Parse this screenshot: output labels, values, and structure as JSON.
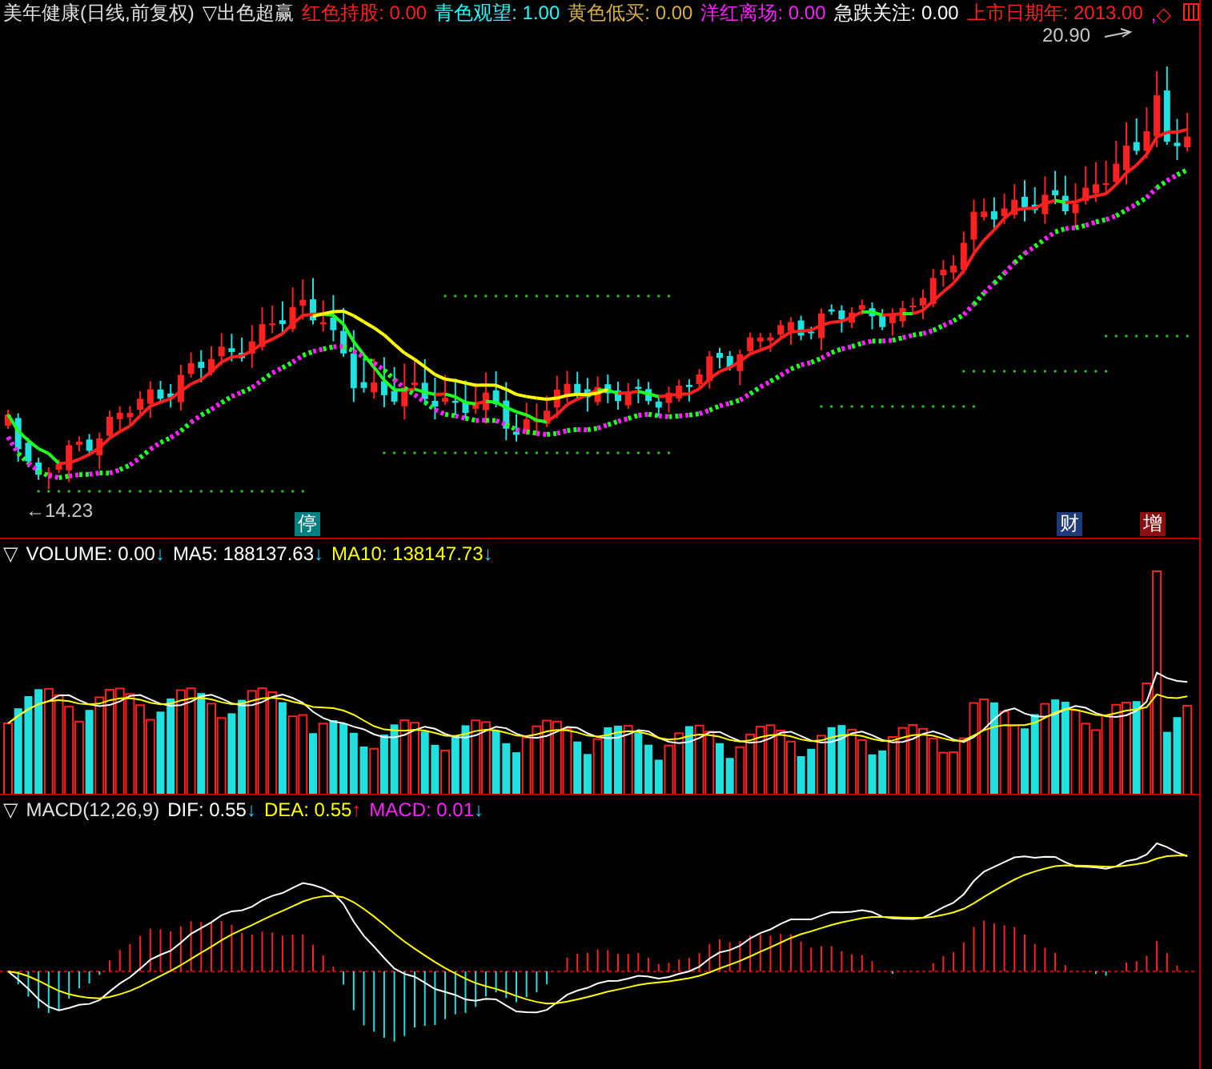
{
  "header": {
    "title": "美年健康(日线,前复权)",
    "indicator": "▽出色超赢",
    "readings": [
      {
        "label": "红色持股:",
        "value": "0.00",
        "color": "#ff2020"
      },
      {
        "label": "青色观望:",
        "value": "1.00",
        "color": "#20ffff"
      },
      {
        "label": "黄色低买:",
        "value": "0.00",
        "color": "#d8b040"
      },
      {
        "label": "洋红离场:",
        "value": "0.00",
        "color": "#ff20ff"
      },
      {
        "label": "急跌关注:",
        "value": "0.00",
        "color": "#ffffff"
      },
      {
        "label": "上市日期年:",
        "value": "2013.00",
        "color": "#ff2020"
      }
    ],
    "marks": [
      {
        "text": ",",
        "color": "#ff20ff"
      },
      {
        "text": "◇",
        "color": "#ff2020"
      }
    ]
  },
  "price_chart": {
    "high_label": "20.90",
    "low_label": "←14.23",
    "event_markers": [
      {
        "text": "停",
        "color": "#008080"
      },
      {
        "text": "财",
        "color": "#1e3a78"
      },
      {
        "text": "增",
        "color": "#8a1010"
      }
    ]
  },
  "volume_panel": {
    "toggle": "▽",
    "readings": [
      {
        "text": "VOLUME: 0.00",
        "color": "#ffffff",
        "arrow": "↓",
        "rising": false
      },
      {
        "text": "MA5: 188137.63",
        "color": "#ffffff",
        "arrow": "↓",
        "rising": false
      },
      {
        "text": "MA10: 138147.73",
        "color": "#ffff00",
        "arrow": "↓",
        "rising": false
      }
    ]
  },
  "macd_panel": {
    "toggle": "▽",
    "name": "MACD(12,26,9)",
    "readings": [
      {
        "text": "DIF: 0.55",
        "color": "#ffffff",
        "arrow": "↓",
        "rising": false
      },
      {
        "text": "DEA: 0.55",
        "color": "#ffff00",
        "arrow": "↑",
        "rising": true
      },
      {
        "text": "MACD: 0.01",
        "color": "#ff20ff",
        "arrow": "↓",
        "rising": false
      }
    ]
  }
}
